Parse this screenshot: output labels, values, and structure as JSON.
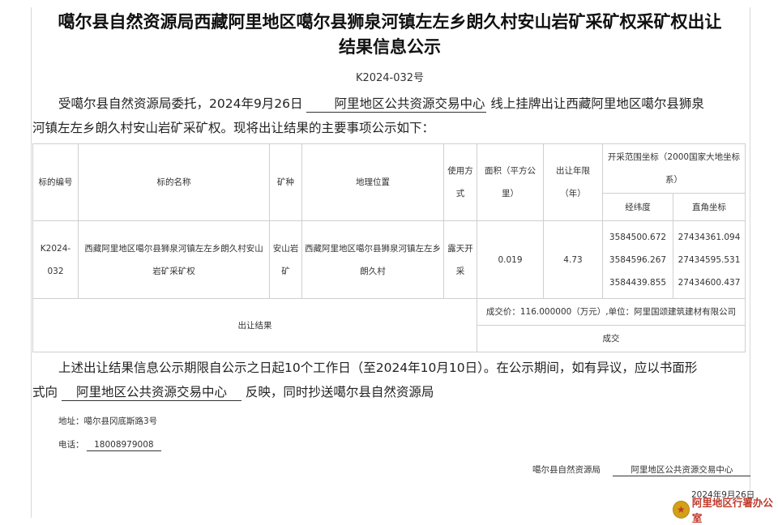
{
  "title_line1": "噶尔县自然资源局西藏阿里地区噶尔县狮泉河镇左左乡朗久村安山岩矿采矿权采矿权出让",
  "title_line2": "结果信息公示",
  "doc_no": "K2024-032号",
  "intro": {
    "pre": "受噶尔县自然资源局委托，2024年9月26日",
    "center": "阿里地区公共资源交易中心",
    "post1": "线上挂牌出让西藏阿里地区噶尔县狮泉",
    "post2": "河镇左左乡朗久村安山岩矿采矿权。现将出让结果的主要事项公示如下："
  },
  "table": {
    "headers": {
      "id": "标的编号",
      "name": "标的名称",
      "mineral": "矿种",
      "location": "地理位置",
      "method": "使用方式",
      "area": "面积（平方公里）",
      "term": "出让年限（年）",
      "range": "开采范围坐标（2000国家大地坐标系）",
      "latlon": "经纬度",
      "rect": "直角坐标"
    },
    "row": {
      "id": "K2024-032",
      "name": "西藏阿里地区噶尔县狮泉河镇左左乡朗久村安山岩矿采矿权",
      "mineral": "安山岩矿",
      "location": "西藏阿里地区噶尔县狮泉河镇左左乡朗久村",
      "method": "露天开采",
      "area": "0.019",
      "term": "4.73",
      "coords": [
        {
          "latlon": "3584500.672",
          "rect": "27434361.094"
        },
        {
          "latlon": "3584596.267",
          "rect": "27434595.531"
        },
        {
          "latlon": "3584439.855",
          "rect": "27434600.437"
        }
      ]
    },
    "result_label": "出让结果",
    "deal_price": "成交价：116.000000（万元）,单位：阿里国颂建筑建材有限公司",
    "deal_status": "成交"
  },
  "notice": {
    "line1": "上述出让结果信息公示期限自公示之日起10个工作日（至2024年10月10日）。在公示期间，如有异议，应以书面形",
    "pre2": "式向",
    "center": "阿里地区公共资源交易中心",
    "post2": "反映，同时抄送噶尔县自然资源局"
  },
  "address_label": "地址：",
  "address_value": "噶尔县冈底斯路3号",
  "phone_label": "电话：",
  "phone_value": "18008979008",
  "sign_org1": "噶尔县自然资源局",
  "sign_org2": "阿里地区公共资源交易中心",
  "sign_date": "2024年9月26日",
  "watermark": "阿里地区行署办公室",
  "colors": {
    "watermark": "#c0392b",
    "emblem": "#d4a017"
  }
}
